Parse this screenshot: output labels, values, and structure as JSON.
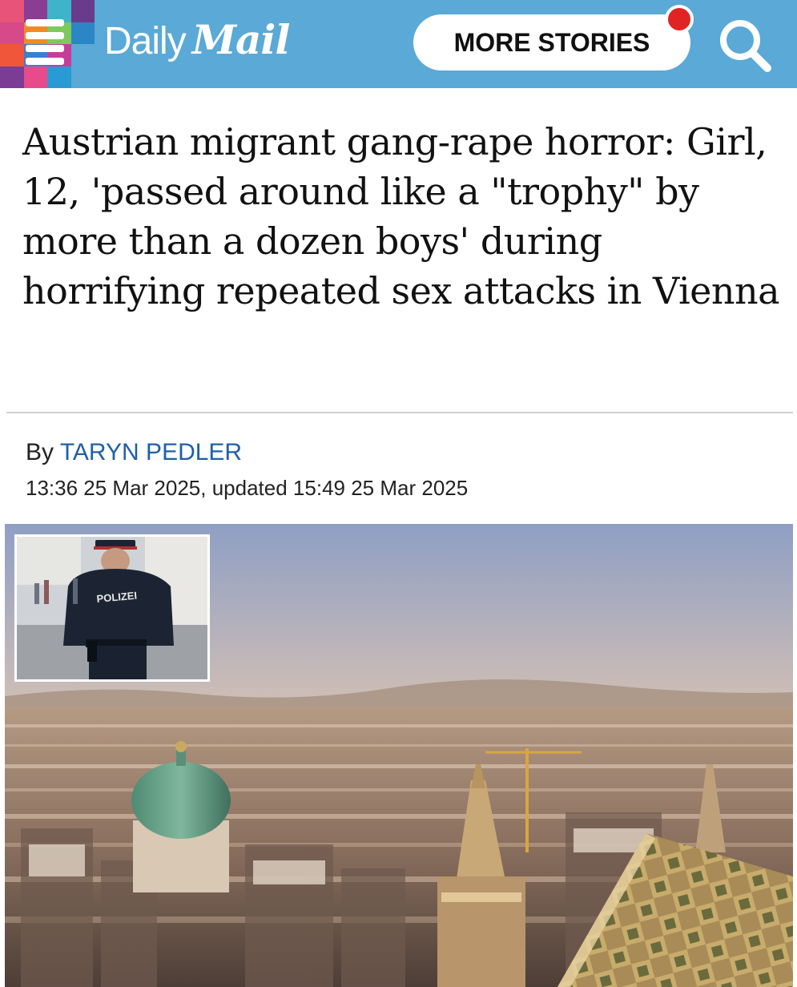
{
  "header": {
    "brand_daily": "Daily",
    "brand_mail": "Mail",
    "more_stories_label": "MORE STORIES",
    "menu_icon": "hamburger-menu-icon",
    "search_icon": "search-icon",
    "background_color": "#5aa9d6",
    "notification_color": "#e02424"
  },
  "article": {
    "headline": "Austrian migrant gang-rape horror: Girl, 12, 'passed around like a \"trophy\" by more than a dozen boys' during horrifying repeated sex attacks in Vienna",
    "byline_prefix": "By",
    "author": "TARYN PEDLER",
    "dateline": "13:36 25 Mar 2025, updated 15:49 25 Mar 2025",
    "author_color": "#1f5fa8"
  },
  "images": {
    "inset_badge_text": "POLIZEI"
  }
}
